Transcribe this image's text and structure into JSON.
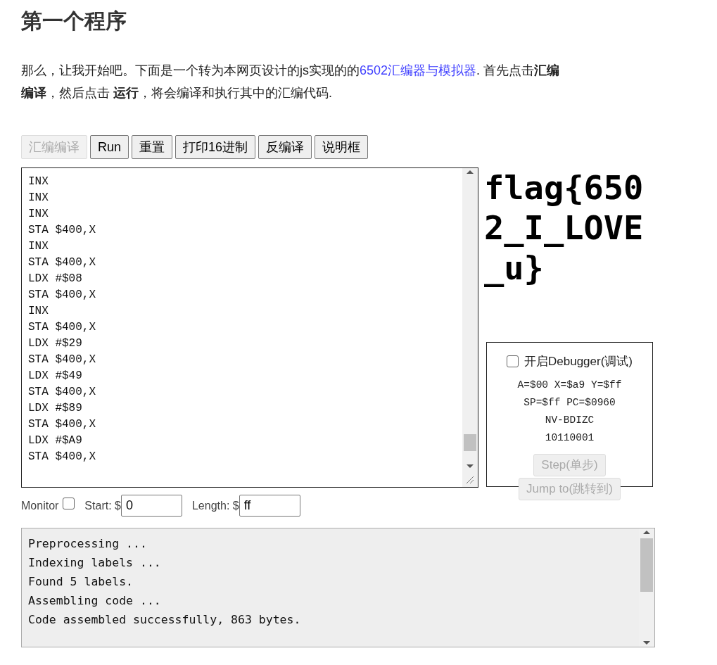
{
  "heading": "第一个程序",
  "intro": {
    "before": "那么，让我开始吧。下面是一个转为本网页设计的js实现的的",
    "link": "6502汇编器与模拟器",
    "after": ". 首先点击**汇编编译**，然后点击 **运行**，将会编译和执行其中的汇编代码."
  },
  "toolbar": [
    {
      "label": "汇编编译",
      "disabled": true
    },
    {
      "label": "Run",
      "disabled": false
    },
    {
      "label": "重置",
      "disabled": false
    },
    {
      "label": "打印16进制",
      "disabled": false
    },
    {
      "label": "反编译",
      "disabled": false
    },
    {
      "label": "说明框",
      "disabled": false
    }
  ],
  "code_lines": [
    "INX",
    "INX",
    "INX",
    "STA $400,X",
    "INX",
    "STA $400,X",
    "LDX #$08",
    "STA $400,X",
    "INX",
    "STA $400,X",
    "LDX #$29",
    "STA $400,X",
    "LDX #$49",
    "STA $400,X",
    "LDX #$89",
    "STA $400,X",
    "LDX #$A9",
    "STA $400,X"
  ],
  "screen_lines": [
    "flag{650",
    "2_I_LOVE",
    "_u}"
  ],
  "debugger": {
    "label": "开启Debugger(调试)",
    "checked": false,
    "registers": [
      "A=$00 X=$a9 Y=$ff",
      "SP=$ff PC=$0960",
      "NV-BDIZC",
      "10110001"
    ],
    "buttons": [
      {
        "label": "Step(单步)",
        "disabled": true
      },
      {
        "label": "Jump to(跳转到)",
        "disabled": true
      }
    ]
  },
  "monitor": {
    "label": "Monitor",
    "checked": false,
    "start_label": "Start: $",
    "start": "0",
    "length_label": "Length: $",
    "length": "ff"
  },
  "messages": [
    "Preprocessing ...",
    "Indexing labels ...",
    "Found 5 labels.",
    "Assembling code ...",
    "Code assembled successfully, 863 bytes."
  ]
}
